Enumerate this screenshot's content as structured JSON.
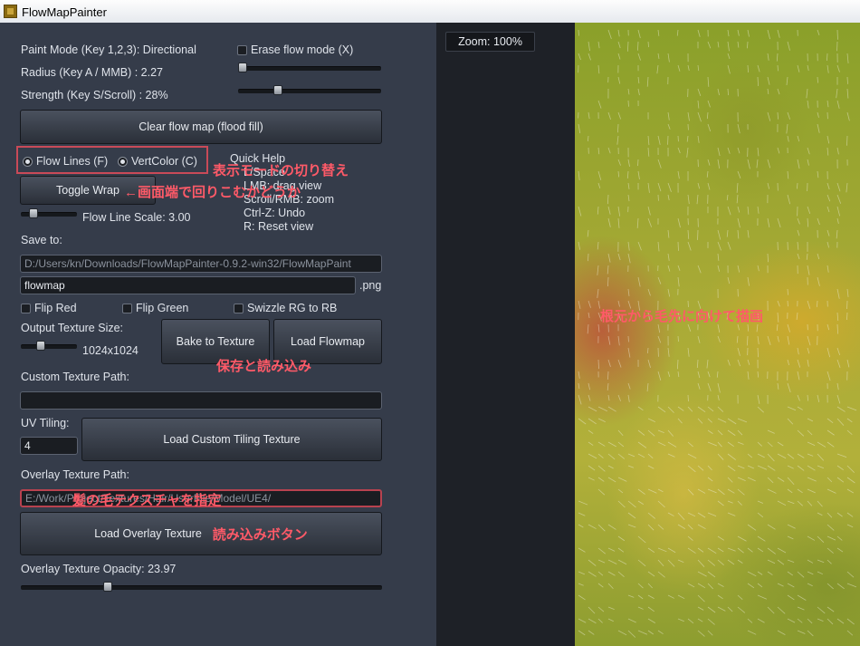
{
  "window": {
    "title": "FlowMapPainter"
  },
  "paint": {
    "mode_label": "Paint Mode (Key 1,2,3): Directional",
    "erase_label": "Erase flow mode (X)",
    "radius_label": "Radius (Key A / MMB) : 2.27",
    "radius_value": 0.03,
    "strength_label": "Strength (Key S/Scroll) : 28%",
    "strength_value": 0.28,
    "clear_button": "Clear flow map (flood fill)"
  },
  "display": {
    "flow_lines_label": "Flow Lines (F)",
    "vertcolor_label": "VertColor (C)",
    "selected": "Flow Lines (F)",
    "toggle_wrap_label": "Toggle Wrap",
    "flow_line_scale_label": "Flow Line Scale: 3.00",
    "flow_line_scale_value": 0.22
  },
  "quick_help": {
    "title": "Quick Help",
    "lines": [
      "L/Space",
      "LMB: drag view",
      "Scroll/RMB: zoom",
      "Ctrl-Z: Undo",
      "R: Reset view"
    ]
  },
  "save": {
    "label": "Save to:",
    "path": "D:/Users/kn/Downloads/FlowMapPainter-0.9.2-win32/FlowMapPaint",
    "filename": "flowmap",
    "extension": ".png",
    "flip_red": "Flip Red",
    "flip_green": "Flip Green",
    "swizzle": "Swizzle RG to RB",
    "output_size_label": "Output Texture Size:",
    "output_size_value": "1024x1024",
    "output_size_level": 0.35,
    "bake_button": "Bake to Texture",
    "load_flowmap_button": "Load Flowmap"
  },
  "custom": {
    "label": "Custom Texture Path:",
    "path": "",
    "uv_tiling_label": "UV Tiling:",
    "uv_tiling_value": "4",
    "load_button": "Load Custom Tiling Texture"
  },
  "overlay": {
    "label": "Overlay Texture Path:",
    "path": "E:/Work/Project/Textures/Hair/UserFile/Model/UE4/",
    "load_button": "Load Overlay Texture",
    "opacity_label": "Overlay Texture Opacity: 23.97",
    "opacity_value": 0.24
  },
  "viewport": {
    "zoom_label": "Zoom: 100%"
  },
  "annotations": {
    "display_mode": "表示モードの切り替え",
    "wrap": "←画面端で回りこむかどうか",
    "save_load": "保存と読み込み",
    "hair_texture": "髪の毛テクスチャを指定",
    "load_button": "読み込みボタン",
    "paint_direction": "根元から毛先に向けて描画"
  },
  "colors": {
    "panel": "#353c4a",
    "annotation": "#ff5a68",
    "canvas": "#9ea733"
  }
}
